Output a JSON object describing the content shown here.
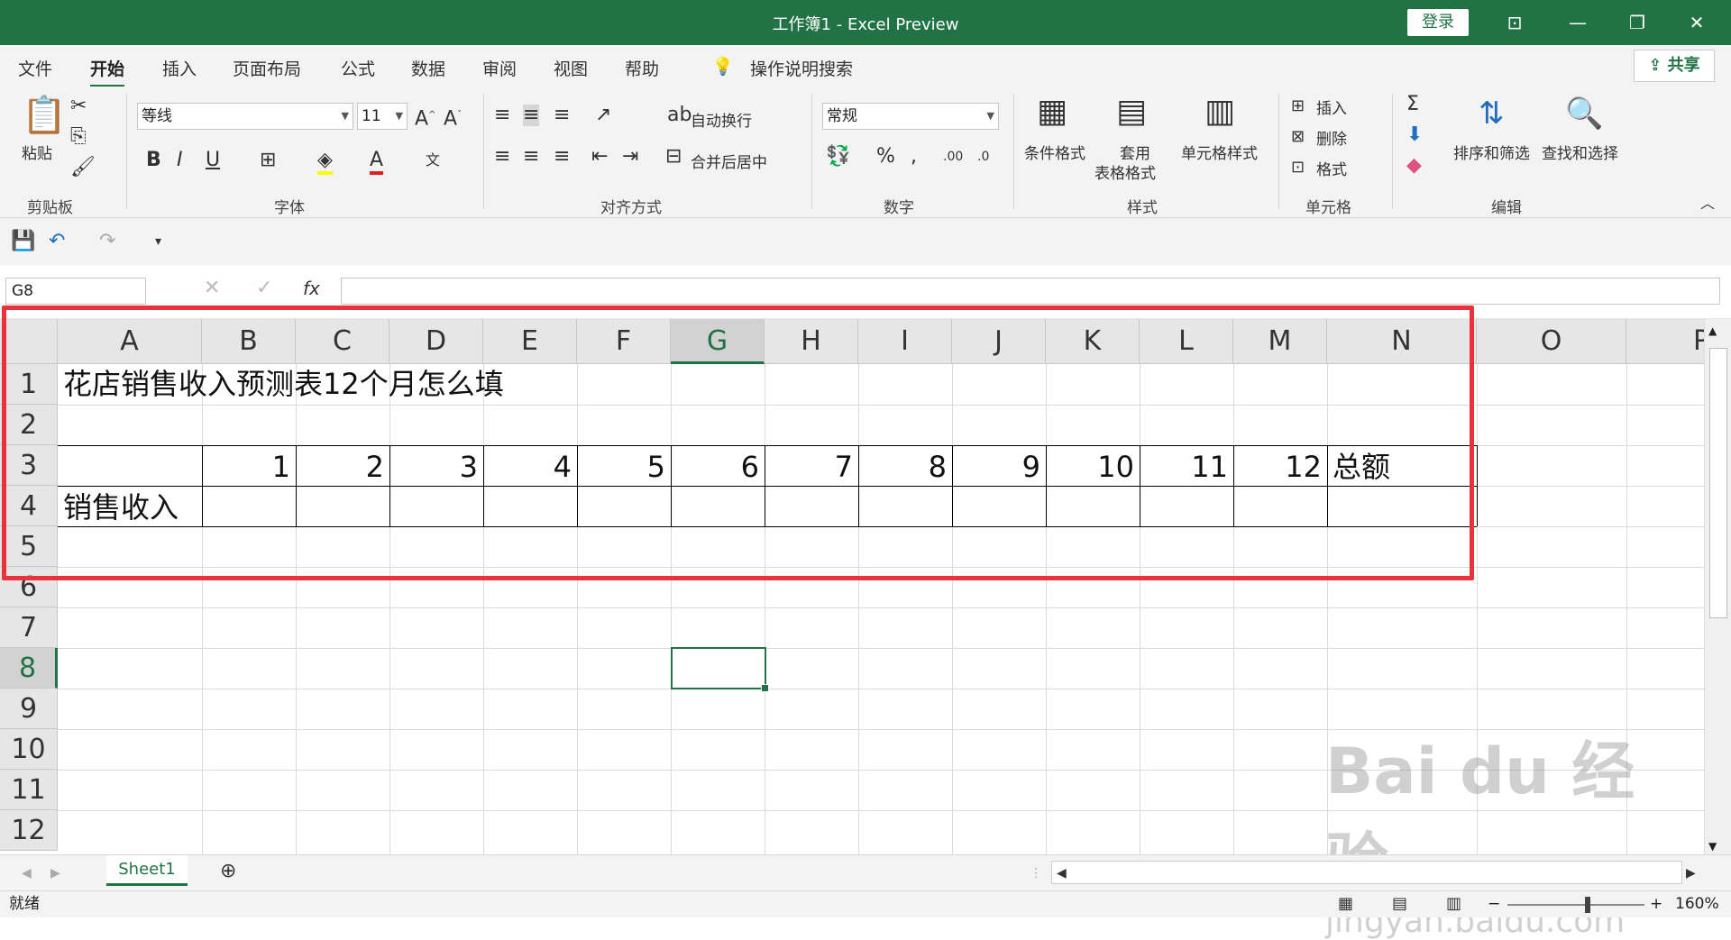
{
  "titlebar": {
    "title": "工作簿1  -  Excel Preview",
    "login": "登录"
  },
  "tabs": [
    "文件",
    "开始",
    "插入",
    "页面布局",
    "公式",
    "数据",
    "审阅",
    "视图",
    "帮助"
  ],
  "search_hint": "操作说明搜索",
  "share": "共享",
  "ribbon": {
    "paste": "粘贴",
    "clipboard_label": "剪贴板",
    "font_name": "等线",
    "font_size": "11",
    "font_label": "字体",
    "wrap": "自动换行",
    "merge": "合并后居中",
    "align_label": "对齐方式",
    "number_format": "常规",
    "number_label": "数字",
    "cond_format": "条件格式",
    "table_format_1": "套用",
    "table_format_2": "表格格式",
    "cell_styles": "单元格样式",
    "styles_label": "样式",
    "insert": "插入",
    "delete": "删除",
    "format": "格式",
    "cells_label": "单元格",
    "sort_filter": "排序和筛选",
    "find_select": "查找和选择",
    "edit_label": "编辑"
  },
  "namebox": "G8",
  "fx": "fx",
  "columns": [
    "A",
    "B",
    "C",
    "D",
    "E",
    "F",
    "G",
    "H",
    "I",
    "J",
    "K",
    "L",
    "M",
    "N",
    "O",
    "P"
  ],
  "rows": [
    "1",
    "2",
    "3",
    "4",
    "5",
    "6",
    "7",
    "8",
    "9",
    "10",
    "11",
    "12"
  ],
  "cells": {
    "a1": "花店销售收入预测表12个月怎么填",
    "a4": "销售收入",
    "months": [
      "1",
      "2",
      "3",
      "4",
      "5",
      "6",
      "7",
      "8",
      "9",
      "10",
      "11",
      "12"
    ],
    "n3": "总额"
  },
  "sheet": {
    "name": "Sheet1"
  },
  "status": {
    "ready": "就绪",
    "zoom": "160%"
  },
  "watermark": "Bai du 经验",
  "watermark_url": "jingyan.baidu.com"
}
